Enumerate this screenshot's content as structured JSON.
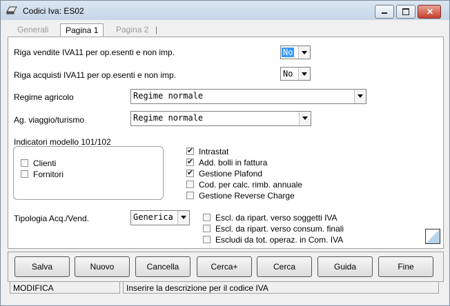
{
  "window": {
    "title": "Codici Iva: ES02"
  },
  "tabs": [
    {
      "label": "Generali"
    },
    {
      "label": "Pagina 1"
    },
    {
      "label": "Pagina 2"
    }
  ],
  "form": {
    "riga_vendite_label": "Riga vendite IVA11 per op.esenti e non imp.",
    "riga_vendite_value": "No",
    "riga_acquisti_label": "Riga acquisti IVA11 per op.esenti e non imp.",
    "riga_acquisti_value": "No",
    "regime_agricolo_label": "Regime agricolo",
    "regime_agricolo_value": "Regime normale",
    "ag_viaggio_label": "Ag. viaggio/turismo",
    "ag_viaggio_value": "Regime normale",
    "indicatori_label": "Indicatori modello 101/102",
    "clienti_label": "Clienti",
    "fornitori_label": "Fornitori",
    "intrastat_label": "Intrastat",
    "add_bolli_label": "Add. bolli in fattura",
    "gestione_plafond_label": "Gestione Plafond",
    "cod_calc_label": "Cod. per calc. rimb. annuale",
    "reverse_charge_label": "Gestione Reverse Charge",
    "tipologia_label": "Tipologia Acq./Vend.",
    "tipologia_value": "Generica",
    "escl_soggetti_label": "Escl. da ripart. verso soggetti IVA",
    "escl_consum_label": "Escl. da ripart. verso consum. finali",
    "escludi_com_label": "Escludi da tot. operaz. in Com. IVA"
  },
  "checkboxes": {
    "clienti": false,
    "fornitori": false,
    "intrastat": true,
    "add_bolli": true,
    "gestione_plafond": true,
    "cod_calc": false,
    "reverse_charge": false,
    "escl_soggetti": false,
    "escl_consum": false,
    "escludi_com": false
  },
  "buttons": {
    "salva": "Salva",
    "nuovo": "Nuovo",
    "cancella": "Cancella",
    "cerca_plus": "Cerca+",
    "cerca": "Cerca",
    "guida": "Guida",
    "fine": "Fine"
  },
  "status": {
    "mode": "MODIFICA",
    "message": "Inserire la descrizione per il codice IVA"
  },
  "colors": {
    "selection": "#3399ff",
    "titlebar": "#c5d6e8"
  }
}
